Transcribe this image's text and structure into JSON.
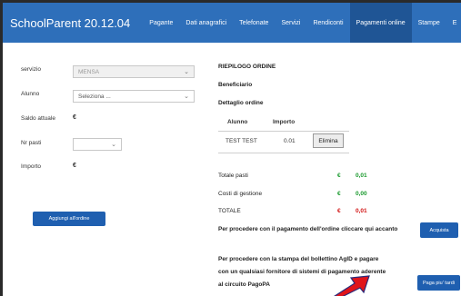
{
  "header": {
    "brand": "SchoolParent 20.12.04",
    "nav": [
      "Pagante",
      "Dati anagrafici",
      "Telefonate",
      "Servizi",
      "Rendiconti",
      "Pagamenti online",
      "Stampe",
      "E"
    ]
  },
  "form": {
    "servizio_label": "servizio",
    "servizio_value": "MENSA",
    "alunno_label": "Alunno",
    "alunno_value": "Seleziona ...",
    "saldo_label": "Saldo attuale",
    "saldo_value": "€",
    "pasti_label": "Nr pasti",
    "importo_label": "Importo",
    "importo_value": "€",
    "add_button": "Aggiungi all'ordine"
  },
  "order": {
    "title": "RIEPILOGO ORDINE",
    "beneficiario": "Beneficiario",
    "dettaglio": "Dettaglio ordine",
    "columns": [
      "Alunno",
      "Importo"
    ],
    "rows": [
      {
        "alunno": "TEST TEST",
        "importo": "0.01",
        "action": "Elimina"
      }
    ],
    "totale_pasti_label": "Totale pasti",
    "totale_pasti_currency": "€",
    "totale_pasti_value": "0,01",
    "costi_label": "Costi di gestione",
    "costi_currency": "€",
    "costi_value": "0,00",
    "totale_label": "TOTALE",
    "totale_currency": "€",
    "totale_value": "0,01",
    "pay_text": "Per procedere con il pagamento dell'ordine cliccare qui accanto",
    "pay_button": "Acquista",
    "later_text_1": "Per procedere con la stampa del bollettino AgID e pagare",
    "later_text_2": "con un qualsiasi fornitore di sistemi di pagamento aderente",
    "later_text_3": "al circuito PagoPA",
    "later_button": "Paga piu' tardi"
  },
  "colors": {
    "navbar": "#2e6fba",
    "nav_active": "#1f5595",
    "button": "#1f5fb0",
    "green": "#1a9a2e",
    "red": "#d21414",
    "arrow": "#e0141a"
  }
}
